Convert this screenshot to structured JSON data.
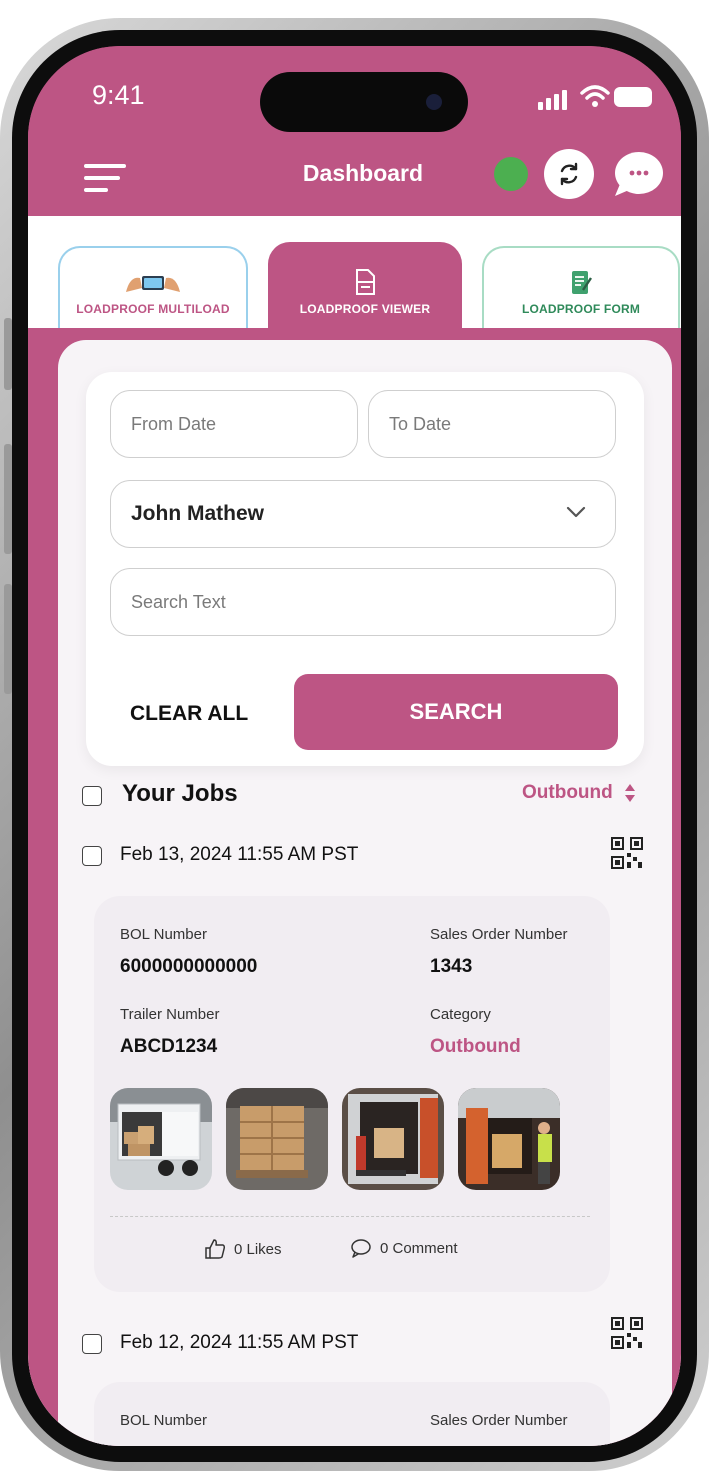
{
  "status_bar": {
    "time": "9:41"
  },
  "header": {
    "title": "Dashboard",
    "menu_icon": "hamburger-menu-icon",
    "status_color": "#4caf50",
    "sync_icon": "sync-icon",
    "chat_icon": "chat-bubble-icon"
  },
  "tabs": [
    {
      "label": "LOADPROOF MULTILOAD",
      "icon": "multiload-icon",
      "active": false
    },
    {
      "label": "LOADPROOF VIEWER",
      "icon": "document-viewer-icon",
      "active": true
    },
    {
      "label": "LOADPROOF FORM",
      "icon": "form-icon",
      "active": false
    }
  ],
  "filters": {
    "from_date_placeholder": "From Date",
    "to_date_placeholder": "To Date",
    "user_selected": "John Mathew",
    "search_placeholder": "Search Text",
    "clear_label": "CLEAR ALL",
    "search_label": "SEARCH"
  },
  "jobs": {
    "title": "Your Jobs",
    "sort_label": "Outbound",
    "items": [
      {
        "date": "Feb 13, 2024 11:55 AM PST",
        "bol_label": "BOL Number",
        "bol_value": "6000000000000",
        "sales_label": "Sales Order Number",
        "sales_value": "1343",
        "trailer_label": "Trailer Number",
        "trailer_value": "ABCD1234",
        "category_label": "Category",
        "category_value": "Outbound",
        "likes": "0 Likes",
        "comments": "0 Comment"
      },
      {
        "date": "Feb 12, 2024 11:55 AM PST",
        "bol_label": "BOL Number",
        "sales_label": "Sales Order Number"
      }
    ]
  },
  "colors": {
    "brand": "#bd5584",
    "status_online": "#4caf50",
    "form_tab": "#2f8a5a"
  }
}
